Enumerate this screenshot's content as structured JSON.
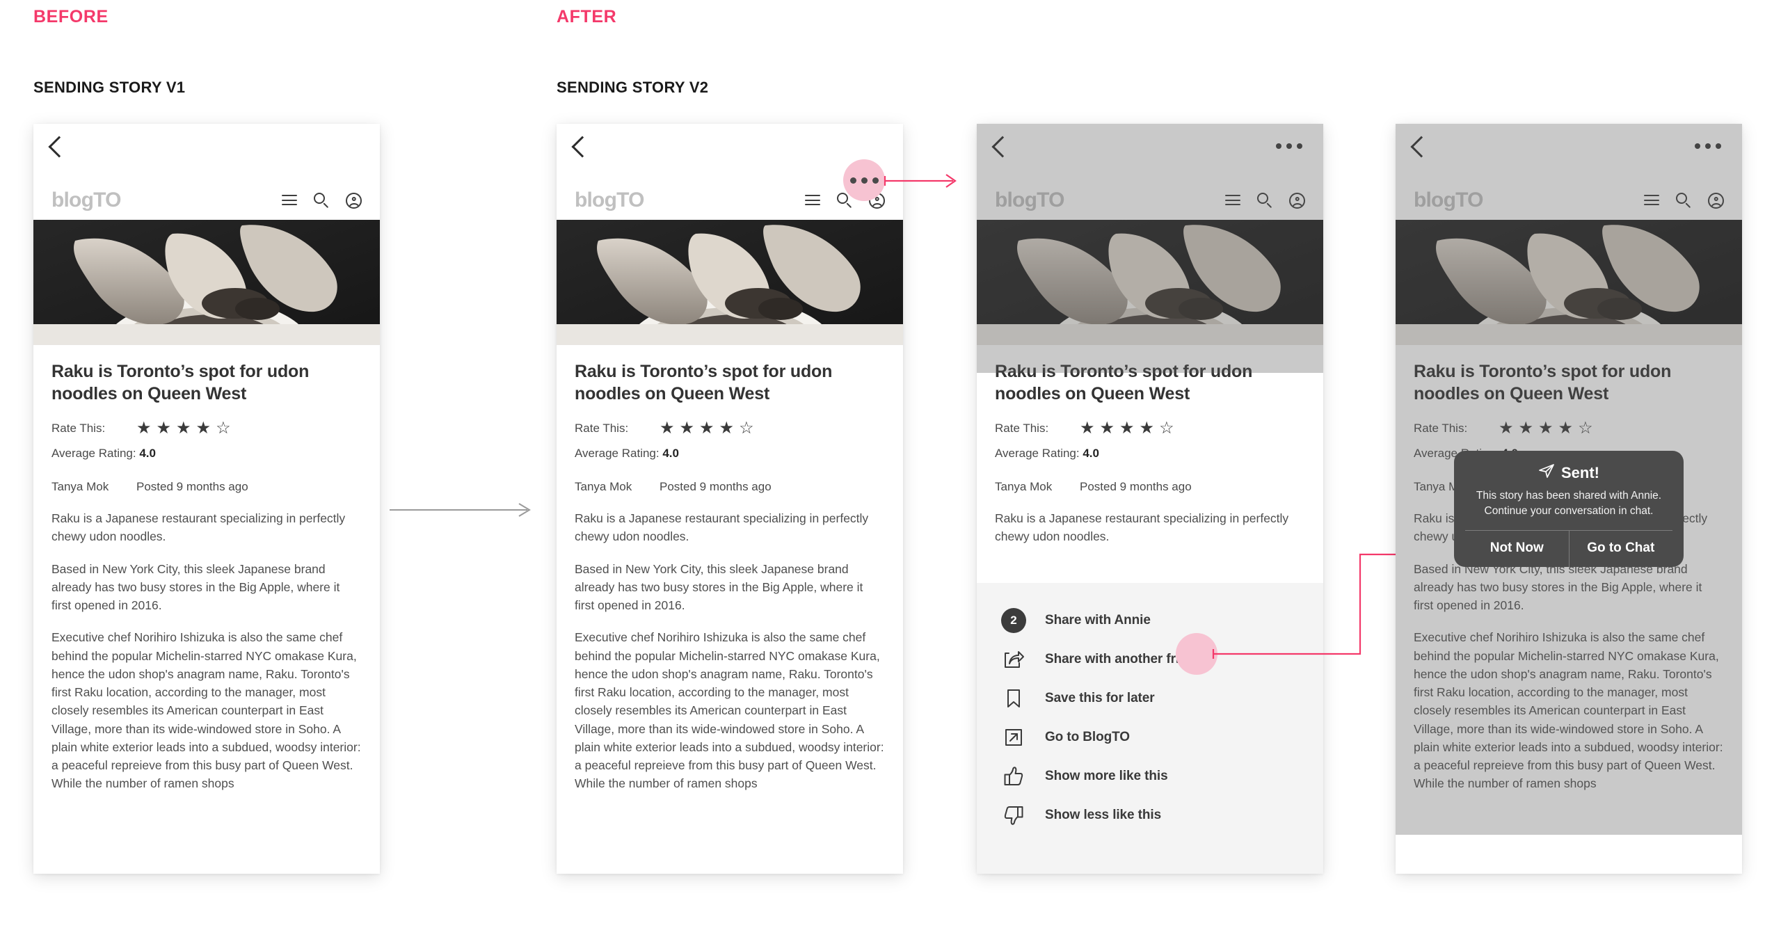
{
  "labels": {
    "before": "BEFORE",
    "after": "AFTER",
    "v1_title": "SENDING STORY V1",
    "v2_title": "SENDING STORY V2"
  },
  "colors": {
    "accent_pink": "#f4396a",
    "hotspot_pink": "#f7c3d2",
    "toast_bg": "#4b4b4b",
    "sheet_bg": "#f4f4f4",
    "dim_overlay": "rgba(90,90,90,0.33)",
    "logo_gray": "#c0c0c0"
  },
  "app_header": {
    "back_icon": "chevron-left-icon",
    "overflow_icon": "more-horizontal-icon",
    "brand": "blogTO",
    "icons": [
      "hamburger-icon",
      "search-icon",
      "account-icon"
    ]
  },
  "article": {
    "title": "Raku is Toronto’s spot for udon noodles on Queen West",
    "rate_label": "Rate This:",
    "rating_filled": 4,
    "rating_total": 5,
    "average_label": "Average Rating:",
    "average_value": "4.0",
    "author": "Tanya Mok",
    "posted": "Posted 9 months ago",
    "paragraphs": [
      "Raku is a Japanese restaurant specializing in perfectly chewy udon noodles.",
      "Based in New York City, this sleek Japanese brand already has two busy stores in the Big Apple, where it first opened in 2016.",
      "Executive chef Norihiro Ishizuka is also the same chef behind the popular Michelin-starred NYC omakase Kura, hence the udon shop's anagram name, Raku. Toronto's first Raku location, according to the manager, most closely resembles its American counterpart in East Village, more than its wide-windowed store in Soho. A plain white exterior leads into a subdued, woodsy interior: a peaceful repreieve from this busy part of Queen West. While the number of ramen shops"
    ]
  },
  "share_sheet": {
    "items": [
      {
        "icon": "badge-count-icon",
        "badge": "2",
        "label": "Share with Annie"
      },
      {
        "icon": "share-arrow-icon",
        "badge": "",
        "label": "Share with another friend"
      },
      {
        "icon": "bookmark-icon",
        "badge": "",
        "label": "Save this for later"
      },
      {
        "icon": "external-link-icon",
        "badge": "",
        "label": "Go to BlogTO"
      },
      {
        "icon": "thumbs-up-icon",
        "badge": "",
        "label": "Show more like this"
      },
      {
        "icon": "thumbs-down-icon",
        "badge": "",
        "label": "Show less like this"
      }
    ]
  },
  "toast": {
    "icon": "paper-plane-icon",
    "title": "Sent!",
    "message": "This story has been shared with Annie. Continue your conversation in chat.",
    "buttons": [
      {
        "label": "Not Now"
      },
      {
        "label": "Go to Chat"
      }
    ]
  },
  "hotspots": {
    "overflow_hotspot": "more-horizontal-icon",
    "share_annie_hotspot": "share-with-annie-tap-target"
  }
}
